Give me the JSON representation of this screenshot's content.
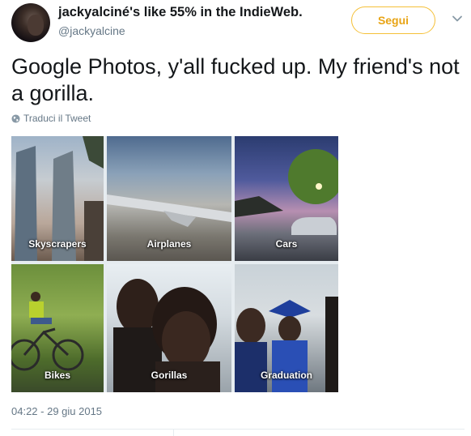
{
  "user": {
    "display_name": "jackyalciné's like 55% in the IndieWeb.",
    "handle": "@jackyalcine",
    "avatar_icon": "user-avatar"
  },
  "follow_button": {
    "label": "Segui",
    "color": "#f5c038"
  },
  "menu_icon": "chevron-down-icon",
  "tweet": {
    "text": "Google Photos, y'all fucked up. My friend's not a gorilla.",
    "translate_label": "Traduci il Tweet",
    "timestamp": "04:22 - 29 giu 2015"
  },
  "photo_grid": {
    "tiles": [
      {
        "label": "Skyscrapers"
      },
      {
        "label": "Airplanes"
      },
      {
        "label": "Cars"
      },
      {
        "label": "Bikes"
      },
      {
        "label": "Gorillas"
      },
      {
        "label": "Graduation"
      }
    ]
  }
}
